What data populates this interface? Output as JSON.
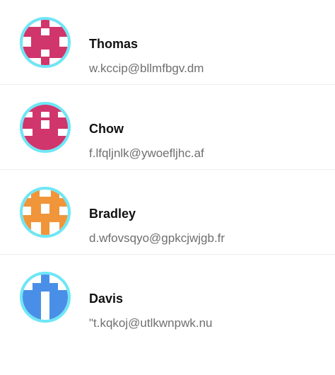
{
  "contacts": [
    {
      "name": "Thomas",
      "email": "w.kccip@bllmfbgv.dm",
      "avatar_color": "#d0356b",
      "avatar_icon": "identicon-pattern-icon"
    },
    {
      "name": "Chow",
      "email": "f.lfqljnlk@ywoefljhc.af",
      "avatar_color": "#d0356b",
      "avatar_icon": "identicon-pattern-icon"
    },
    {
      "name": "Bradley",
      "email": "d.wfovsqyo@gpkcjwjgb.fr",
      "avatar_color": "#f0953a",
      "avatar_icon": "identicon-pattern-icon"
    },
    {
      "name": "Davis",
      "email": "\"t.kqkoj@utlkwnpwk.nu",
      "avatar_color": "#4a8fe7",
      "avatar_icon": "identicon-pattern-icon"
    }
  ],
  "avatar_ring_color": "#6ee7f6"
}
